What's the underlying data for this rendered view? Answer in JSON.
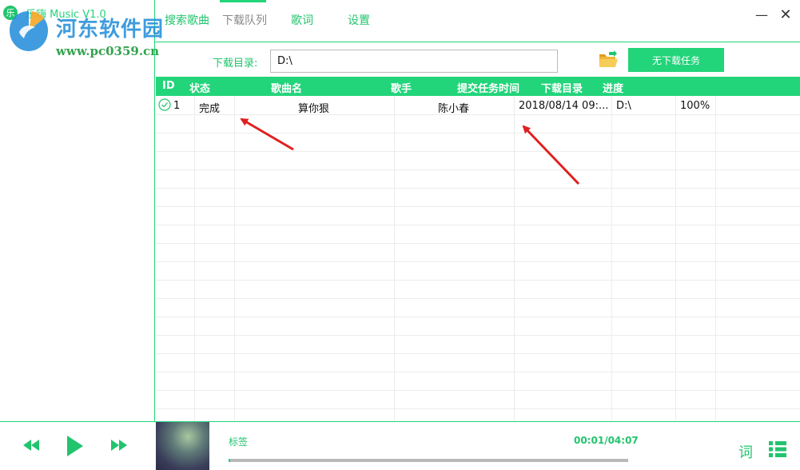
{
  "app": {
    "title": "乐嗨 Music V1.0",
    "logo_char": "乐"
  },
  "watermark": {
    "title": "河东软件园",
    "url": "www.pc0359.cn"
  },
  "tabs": [
    {
      "label": "搜索歌曲"
    },
    {
      "label": "下载队列"
    },
    {
      "label": "歌词"
    },
    {
      "label": "设置"
    }
  ],
  "active_tab": "下载队列",
  "window": {
    "minimize": "—",
    "close": "✕"
  },
  "download": {
    "dir_label": "下载目录:",
    "dir_value": "D:\\",
    "task_button": "无下载任务"
  },
  "table": {
    "headers": [
      "ID",
      "状态",
      "歌曲名",
      "歌手",
      "提交任务时间",
      "下载目录",
      "进度"
    ],
    "rows": [
      {
        "id": "1",
        "status": "完成",
        "song": "算你狠",
        "singer": "陈小春",
        "time": "2018/08/14 09:...",
        "dir": "D:\\",
        "progress": "100%"
      }
    ]
  },
  "player": {
    "track_title": "标签",
    "time": "00:01/04:07",
    "progress_fraction": 0.004,
    "lyric_button": "词"
  },
  "colors": {
    "accent": "#22d47a",
    "text_accent": "#22c46e",
    "arrow": "#e02020"
  }
}
